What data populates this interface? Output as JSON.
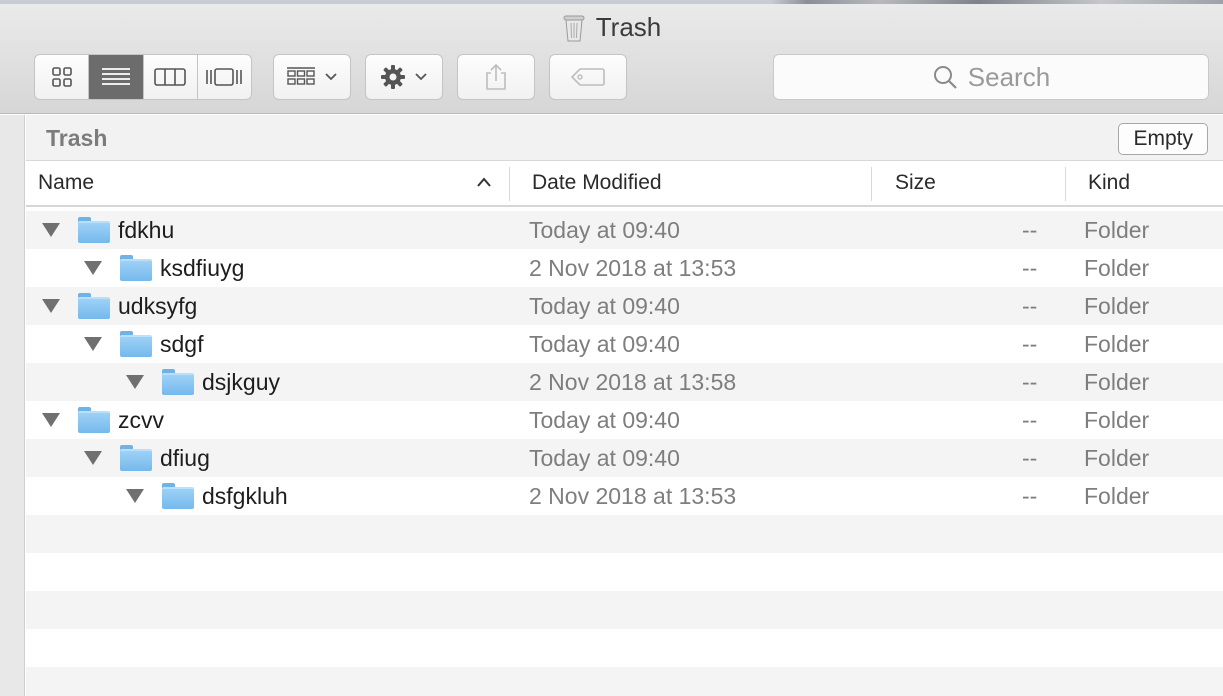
{
  "window": {
    "title": "Trash"
  },
  "toolbar": {
    "view_modes": [
      "icon-view",
      "list-view",
      "column-view",
      "cover-flow-view"
    ],
    "active_view": "list-view",
    "search_placeholder": "Search"
  },
  "pathbar": {
    "title": "Trash",
    "empty_label": "Empty"
  },
  "columns": {
    "name": "Name",
    "date": "Date Modified",
    "size": "Size",
    "kind": "Kind"
  },
  "rows": [
    {
      "name": "fdkhu",
      "date": "Today at 09:40",
      "size": "--",
      "kind": "Folder",
      "level": 0
    },
    {
      "name": "ksdfiuyg",
      "date": "2 Nov 2018 at 13:53",
      "size": "--",
      "kind": "Folder",
      "level": 1
    },
    {
      "name": "udksyfg",
      "date": "Today at 09:40",
      "size": "--",
      "kind": "Folder",
      "level": 0
    },
    {
      "name": "sdgf",
      "date": "Today at 09:40",
      "size": "--",
      "kind": "Folder",
      "level": 1
    },
    {
      "name": "dsjkguy",
      "date": "2 Nov 2018 at 13:58",
      "size": "--",
      "kind": "Folder",
      "level": 2
    },
    {
      "name": "zcvv",
      "date": "Today at 09:40",
      "size": "--",
      "kind": "Folder",
      "level": 0
    },
    {
      "name": "dfiug",
      "date": "Today at 09:40",
      "size": "--",
      "kind": "Folder",
      "level": 1
    },
    {
      "name": "dsfgkluh",
      "date": "2 Nov 2018 at 13:53",
      "size": "--",
      "kind": "Folder",
      "level": 2
    }
  ],
  "colors": {
    "folder": "#74b9ec",
    "active_segment": "#6c6c6c",
    "muted_text": "#7e7e7e"
  }
}
